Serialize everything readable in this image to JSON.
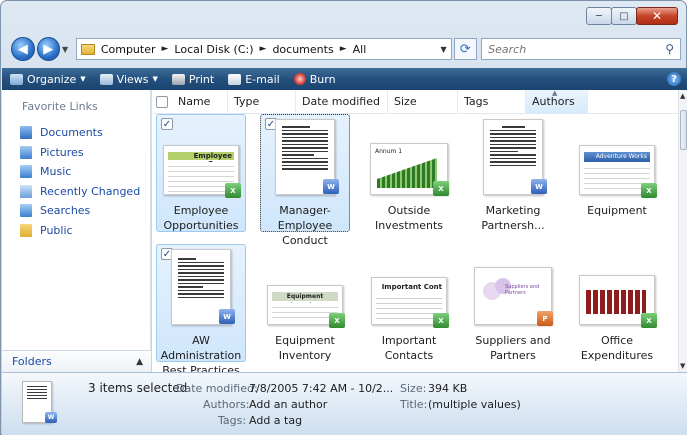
{
  "window": {
    "caption": {
      "minimize": "─",
      "maximize": "□",
      "close": "✕"
    }
  },
  "address": {
    "crumbs": [
      "Computer",
      "Local Disk (C:)",
      "documents",
      "All"
    ],
    "separator": "►",
    "search_placeholder": "Search"
  },
  "toolbar": {
    "organize": "Organize",
    "views": "Views",
    "print": "Print",
    "email": "E-mail",
    "burn": "Burn",
    "help": "?"
  },
  "sidebar": {
    "title": "Favorite Links",
    "items": [
      {
        "label": "Documents",
        "icon": "documents-icon",
        "color": "#3f7fcf"
      },
      {
        "label": "Pictures",
        "icon": "pictures-icon",
        "color": "#4a8fd6"
      },
      {
        "label": "Music",
        "icon": "music-icon",
        "color": "#4a8fd6"
      },
      {
        "label": "Recently Changed",
        "icon": "recently-changed-icon",
        "color": "#6aa0dc"
      },
      {
        "label": "Searches",
        "icon": "searches-icon",
        "color": "#4a8fd6"
      },
      {
        "label": "Public",
        "icon": "public-folder-icon",
        "color": "#e8b33f"
      }
    ],
    "folders_label": "Folders"
  },
  "columns": [
    "Name",
    "Type",
    "Date modified",
    "Size",
    "Tags",
    "Authors"
  ],
  "files": [
    {
      "label": "Employee Opportunities",
      "type": "excel",
      "selected": true
    },
    {
      "label": "Manager-Employee Conduct",
      "type": "word",
      "selected": true
    },
    {
      "label": "Outside Investments",
      "type": "excel",
      "selected": false
    },
    {
      "label": "Marketing Partnersh...",
      "type": "word",
      "selected": false
    },
    {
      "label": "Equipment",
      "type": "excel",
      "selected": false
    },
    {
      "label": "AW Administration Best Practices",
      "type": "word",
      "selected": true
    },
    {
      "label": "Equipment Inventory",
      "type": "excel",
      "selected": false
    },
    {
      "label": "Important Contacts",
      "type": "excel",
      "selected": false
    },
    {
      "label": "Suppliers and Partners",
      "type": "powerpoint",
      "selected": false
    },
    {
      "label": "Office Expenditures",
      "type": "excel",
      "selected": false
    }
  ],
  "thumb_text": {
    "employee": "Employee Oppor",
    "inventory": "Equipment Inventor",
    "contacts": "Important Cont",
    "adventure": "Adventure Works",
    "suppliers": "Suppliers and Partners",
    "annum": "Annum 1"
  },
  "details": {
    "selected_count": "3 items selected",
    "date_label": "Date modified:",
    "date_value": "7/8/2005 7:42 AM - 10/2...",
    "size_label": "Size:",
    "size_value": "394 KB",
    "authors_label": "Authors:",
    "authors_value": "Add an author",
    "title_label": "Title:",
    "title_value": "(multiple values)",
    "tags_label": "Tags:",
    "tags_value": "Add a tag"
  }
}
